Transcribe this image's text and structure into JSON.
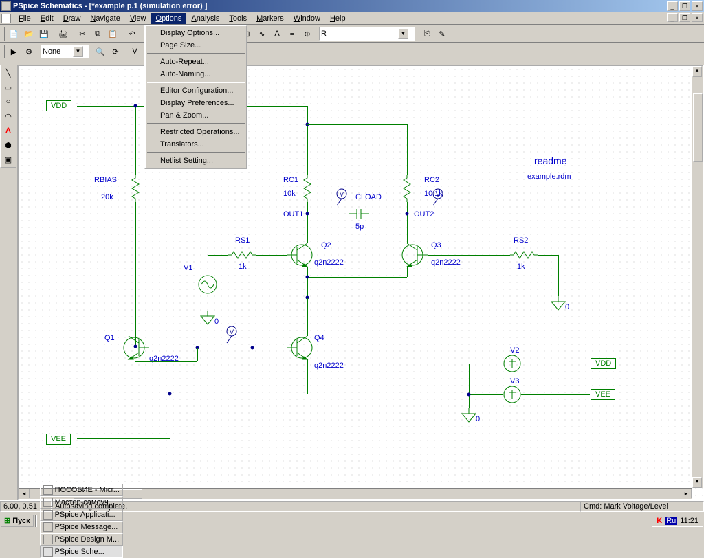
{
  "title": "PSpice Schematics - [*example  p.1  (simulation error) ]",
  "menu": [
    "File",
    "Edit",
    "Draw",
    "Navigate",
    "View",
    "Options",
    "Analysis",
    "Tools",
    "Markers",
    "Window",
    "Help"
  ],
  "menu_open_index": 5,
  "dropdown": {
    "groups": [
      [
        "Display Options...",
        "Page Size..."
      ],
      [
        "Auto-Repeat...",
        "Auto-Naming..."
      ],
      [
        "Editor Configuration...",
        "Display Preferences...",
        "Pan & Zoom..."
      ],
      [
        "Restricted Operations...",
        "Translators..."
      ],
      [
        "Netlist Setting..."
      ]
    ]
  },
  "toolbar2": {
    "part_combo": "R",
    "layer_combo": "None"
  },
  "schematic": {
    "readme_title": "readme",
    "readme_file": "example.rdm",
    "ports": {
      "vdd": "VDD",
      "vee": "VEE",
      "vdd2": "VDD",
      "vee2": "VEE"
    },
    "labels": {
      "rbias": "RBIAS",
      "rbias_v": "20k",
      "rc1": "RC1",
      "rc1_v": "10k",
      "rc2": "RC2",
      "rc2_v": "10.1k",
      "cload": "CLOAD",
      "cload_v": "5p",
      "out1": "OUT1",
      "out2": "OUT2",
      "rs1": "RS1",
      "rs1_v": "1k",
      "rs2": "RS2",
      "rs2_v": "1k",
      "v1": "V1",
      "q1": "Q1",
      "q1_m": "q2n2222",
      "q2": "Q2",
      "q2_m": "q2n2222",
      "q3": "Q3",
      "q3_m": "q2n2222",
      "q4": "Q4",
      "q4_m": "q2n2222",
      "v2": "V2",
      "v3": "V3",
      "gnd": "0"
    }
  },
  "status": {
    "coords": "6.00, 0.51",
    "msg": "Autosaving complete.",
    "cmd": "Cmd: Mark Voltage/Level"
  },
  "taskbar": {
    "start": "Пуск",
    "items": [
      {
        "label": "ПОСОБИЕ - Micr..."
      },
      {
        "label": "Мастер-самоуч..."
      },
      {
        "label": "PSpice Applicati..."
      },
      {
        "label": "PSpice Message..."
      },
      {
        "label": "PSpice Design M..."
      },
      {
        "label": "PSpice Sche...",
        "active": true
      }
    ],
    "lang": "Ru",
    "clock": "11:21"
  }
}
